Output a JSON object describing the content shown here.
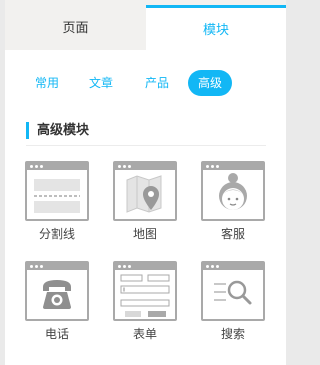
{
  "top_tabs": [
    {
      "label": "页面"
    },
    {
      "label": "模块"
    }
  ],
  "sub_tabs": [
    {
      "label": "常用"
    },
    {
      "label": "文章"
    },
    {
      "label": "产品"
    },
    {
      "label": "高级"
    }
  ],
  "section": {
    "title": "高级模块"
  },
  "modules": [
    {
      "label": "分割线",
      "icon": "divider-icon"
    },
    {
      "label": "地图",
      "icon": "map-icon"
    },
    {
      "label": "客服",
      "icon": "customer-service-icon"
    },
    {
      "label": "电话",
      "icon": "phone-icon"
    },
    {
      "label": "表单",
      "icon": "form-icon"
    },
    {
      "label": "搜索",
      "icon": "search-icon"
    }
  ],
  "colors": {
    "accent": "#12b7f5",
    "icon_gray": "#a9a9a9",
    "tab_bar_bg": "#f2f1ef"
  }
}
